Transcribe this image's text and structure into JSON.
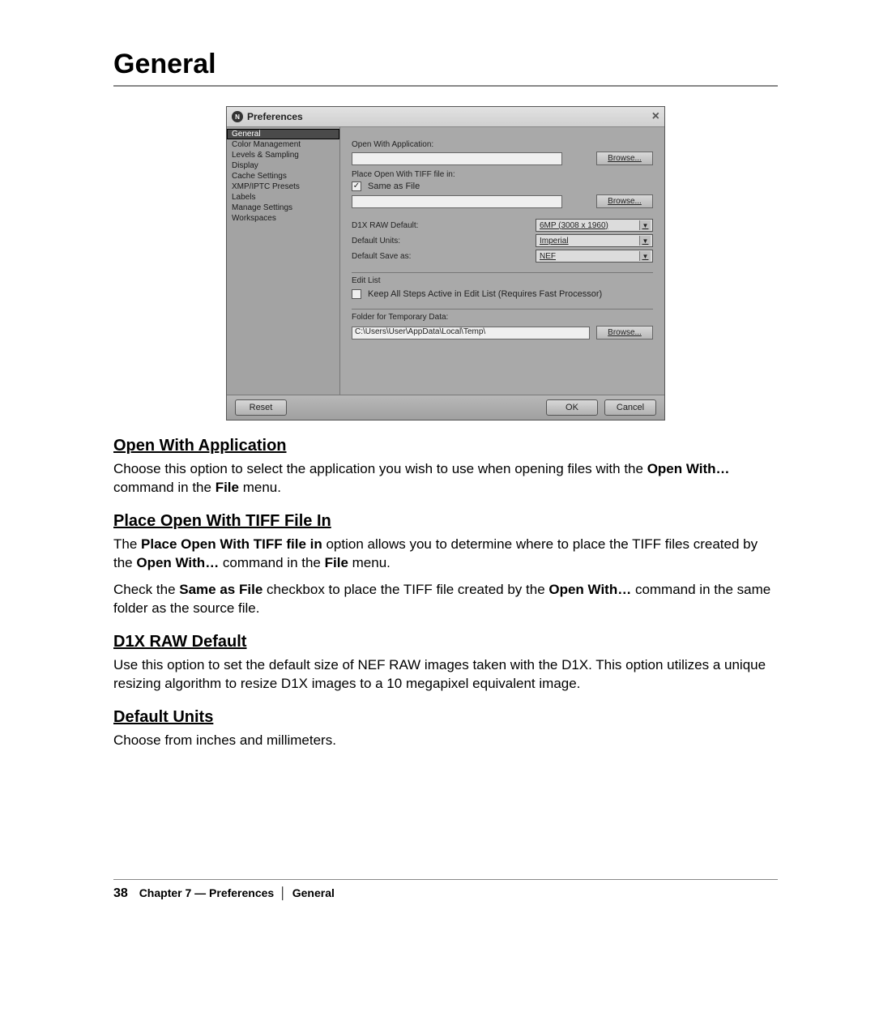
{
  "page": {
    "title": "General",
    "number": "38",
    "chapter": "Chapter 7 — Preferences",
    "section": "General"
  },
  "dialog": {
    "title": "Preferences",
    "sidebar": [
      "General",
      "Color Management",
      "Levels & Sampling",
      "Display",
      "Cache Settings",
      "XMP/IPTC Presets",
      "Labels",
      "Manage Settings",
      "Workspaces"
    ],
    "selected_index": 0,
    "open_with": {
      "label": "Open With Application:",
      "value": "",
      "browse": "Browse..."
    },
    "place_tiff": {
      "label": "Place Open With TIFF file in:",
      "same_as_file_checked": true,
      "same_as_file_label": "Same as File",
      "path_value": "",
      "browse": "Browse..."
    },
    "d1x": {
      "label": "D1X RAW Default:",
      "value": "6MP (3008 x 1960)"
    },
    "units": {
      "label": "Default Units:",
      "value": "Imperial"
    },
    "save_as": {
      "label": "Default Save as:",
      "value": "NEF"
    },
    "edit_list": {
      "heading": "Edit List",
      "keep_steps_checked": false,
      "keep_steps_label": "Keep All Steps Active in Edit List (Requires Fast Processor)"
    },
    "temp": {
      "heading": "Folder for Temporary Data:",
      "path": "C:\\Users\\User\\AppData\\Local\\Temp\\",
      "browse": "Browse..."
    },
    "buttons": {
      "reset": "Reset",
      "ok": "OK",
      "cancel": "Cancel"
    }
  },
  "sections": {
    "s1": {
      "heading": "Open With Application",
      "p1a": "Choose this option to select the application you wish to use when opening files with the ",
      "p1b": "Open With…",
      "p1c": " command in the ",
      "p1d": "File",
      "p1e": " menu."
    },
    "s2": {
      "heading": "Place Open With TIFF File In",
      "p1a": "The ",
      "p1b": "Place Open With TIFF file in",
      "p1c": " option allows you to determine where to place the TIFF files created by the ",
      "p1d": "Open With…",
      "p1e": " command in the ",
      "p1f": "File",
      "p1g": " menu.",
      "p2a": "Check the ",
      "p2b": "Same as File",
      "p2c": " checkbox to place the TIFF file created by the ",
      "p2d": "Open With…",
      "p2e": " command in the same folder as the source file."
    },
    "s3": {
      "heading": "D1X RAW Default",
      "p1": "Use this option to set the default size of NEF RAW images taken with the D1X. This option utilizes a unique resizing algorithm to resize D1X images to a 10 megapixel equivalent image."
    },
    "s4": {
      "heading": "Default Units",
      "p1": "Choose from inches and millimeters."
    }
  }
}
